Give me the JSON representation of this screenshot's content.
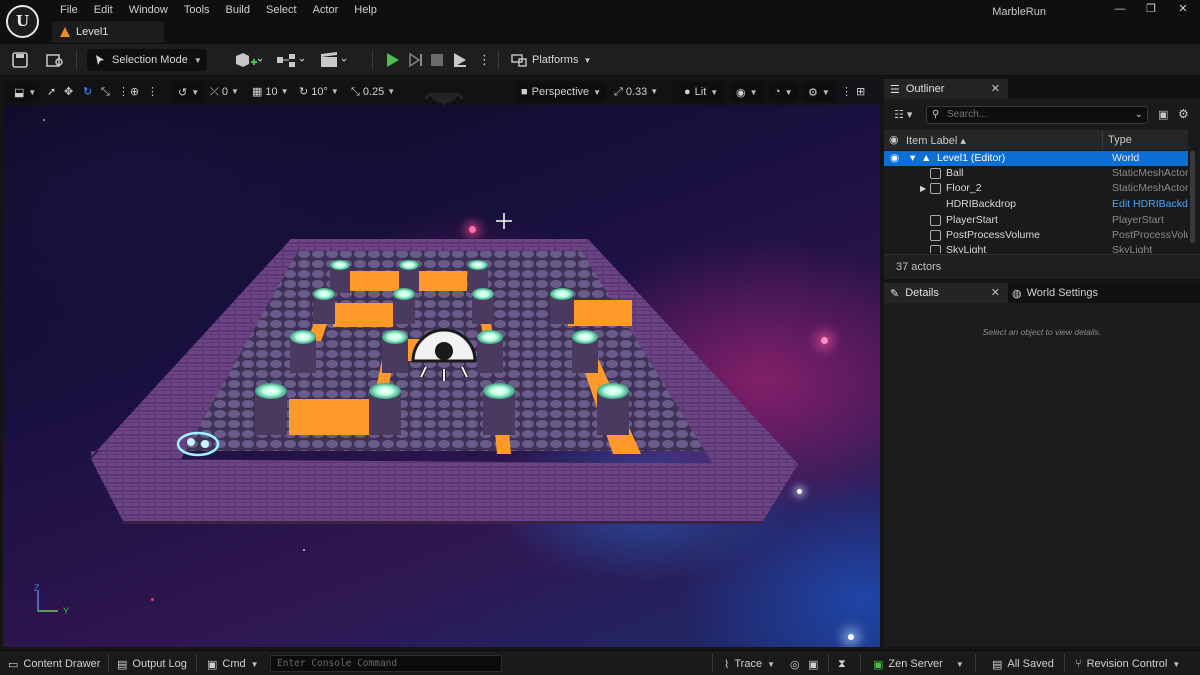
{
  "window": {
    "project_name": "MarbleRun",
    "level_tab": "Level1",
    "menu": [
      "File",
      "Edit",
      "Window",
      "Tools",
      "Build",
      "Select",
      "Actor",
      "Help"
    ]
  },
  "toolbar": {
    "selection_mode": "Selection Mode",
    "platforms": "Platforms"
  },
  "viewport": {
    "perspective": "Perspective",
    "lit": "Lit",
    "camera_speed": "0.33",
    "rotation_snap_value": "0",
    "grid_snap": "10",
    "angle_snap": "10°",
    "scale_snap": "0.25",
    "axis_z": "Z",
    "axis_y": "Y"
  },
  "outliner": {
    "tab_label": "Outliner",
    "search_placeholder": "Search...",
    "col_label": "Item Label",
    "col_type": "Type",
    "rows": [
      {
        "label": "Level1 (Editor)",
        "type": "World"
      },
      {
        "label": "Ball",
        "type": "StaticMeshActor"
      },
      {
        "label": "Floor_2",
        "type": "StaticMeshActor"
      },
      {
        "label": "HDRIBackdrop",
        "type": "Edit HDRIBackdrop"
      },
      {
        "label": "PlayerStart",
        "type": "PlayerStart"
      },
      {
        "label": "PostProcessVolume",
        "type": "PostProcessVolume"
      },
      {
        "label": "SkyLight",
        "type": "SkyLight"
      }
    ],
    "actor_count": "37 actors"
  },
  "details": {
    "tab_label": "Details",
    "world_settings_label": "World Settings",
    "empty_message": "Select an object to view details."
  },
  "statusbar": {
    "content_drawer": "Content Drawer",
    "output_log": "Output Log",
    "cmd": "Cmd",
    "console_placeholder": "Enter Console Command",
    "trace": "Trace",
    "zen_server": "Zen Server",
    "all_saved": "All Saved",
    "revision_control": "Revision Control"
  },
  "colors": {
    "accent_blue": "#0d6ed6",
    "play_green": "#4cbf4c",
    "lava_orange": "#ff9a2a",
    "wall_purple": "#6a3e86"
  }
}
